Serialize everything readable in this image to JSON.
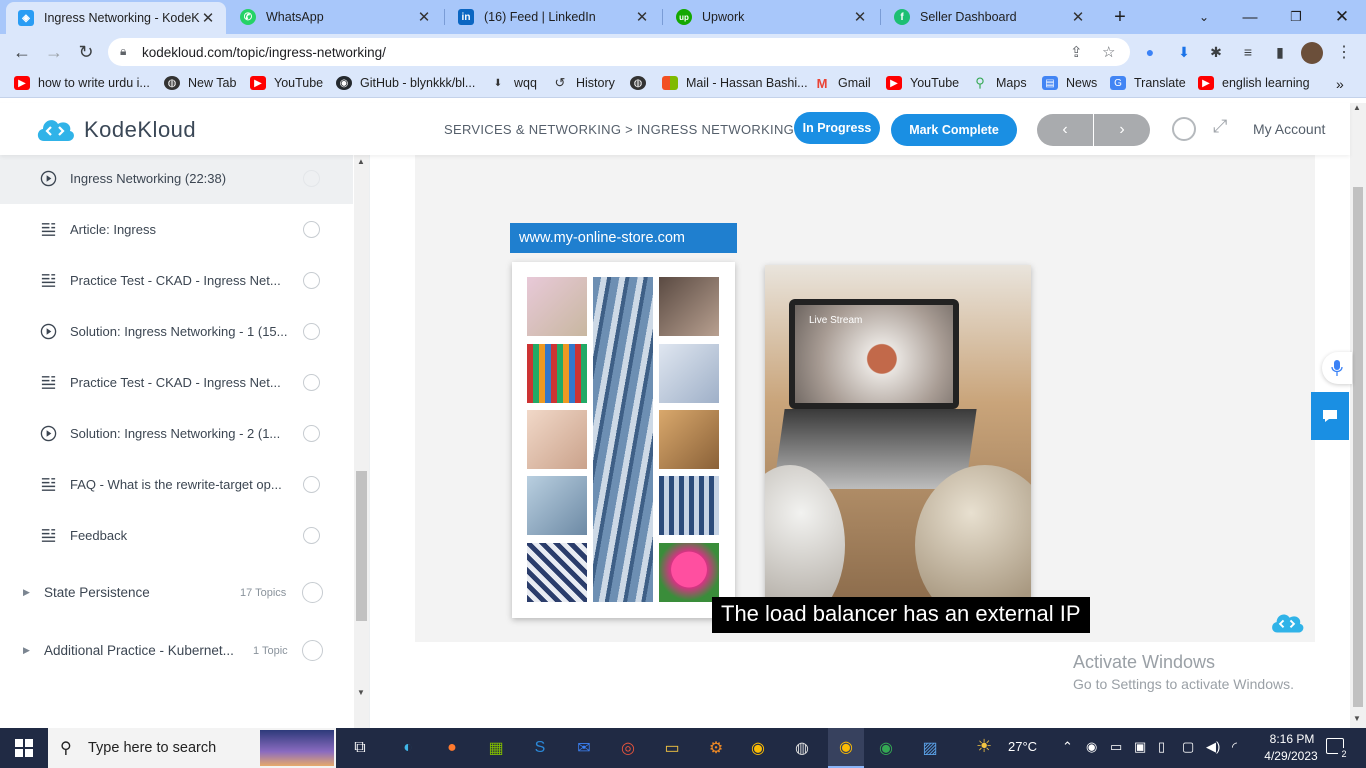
{
  "browser": {
    "tabs": [
      {
        "title": "Ingress Networking - KodeKl",
        "favicon": "kodekloud-icon",
        "active": true
      },
      {
        "title": "WhatsApp",
        "favicon": "whatsapp-icon",
        "active": false
      },
      {
        "title": "(16) Feed | LinkedIn",
        "favicon": "linkedin-icon",
        "active": false
      },
      {
        "title": "Upwork",
        "favicon": "upwork-icon",
        "active": false
      },
      {
        "title": "Seller Dashboard",
        "favicon": "fiverr-icon",
        "active": false
      }
    ],
    "url": "kodekloud.com/topic/ingress-networking/",
    "bookmarks": [
      {
        "label": "how to write urdu i...",
        "icon": "youtube-icon"
      },
      {
        "label": "New Tab",
        "icon": "globe-icon"
      },
      {
        "label": "YouTube",
        "icon": "youtube-icon"
      },
      {
        "label": "GitHub - blynkkk/bl...",
        "icon": "github-icon"
      },
      {
        "label": "wqq",
        "icon": "download-icon"
      },
      {
        "label": "History",
        "icon": "history-icon"
      },
      {
        "label": "",
        "icon": "globe-icon"
      },
      {
        "label": "Mail - Hassan Bashi...",
        "icon": "microsoft-icon"
      },
      {
        "label": "Gmail",
        "icon": "gmail-icon"
      },
      {
        "label": "YouTube",
        "icon": "youtube-icon"
      },
      {
        "label": "Maps",
        "icon": "maps-icon"
      },
      {
        "label": "News",
        "icon": "news-icon"
      },
      {
        "label": "Translate",
        "icon": "translate-icon"
      },
      {
        "label": "english learning",
        "icon": "youtube-icon"
      }
    ]
  },
  "site": {
    "logo": "KodeKloud",
    "breadcrumb": "SERVICES & NETWORKING > INGRESS NETWORKING",
    "status_label": "In Progress",
    "mark_complete_label": "Mark Complete",
    "account_label": "My Account"
  },
  "sidebar": {
    "lessons": [
      {
        "label": "Ingress Networking (22:38)",
        "icon": "play-icon",
        "current": true
      },
      {
        "label": "Article: Ingress",
        "icon": "article-icon",
        "current": false
      },
      {
        "label": "Practice Test - CKAD - Ingress Net...",
        "icon": "article-icon",
        "current": false
      },
      {
        "label": "Solution: Ingress Networking - 1 (15...",
        "icon": "play-icon",
        "current": false
      },
      {
        "label": "Practice Test - CKAD - Ingress Net...",
        "icon": "article-icon",
        "current": false
      },
      {
        "label": "Solution: Ingress Networking - 2 (1...",
        "icon": "play-icon",
        "current": false
      },
      {
        "label": "FAQ - What is the rewrite-target op...",
        "icon": "article-icon",
        "current": false
      },
      {
        "label": "Feedback",
        "icon": "article-icon",
        "current": false
      }
    ],
    "topics": [
      {
        "label": "State Persistence",
        "count": "17 Topics"
      },
      {
        "label": "Additional Practice - Kubernet...",
        "count": "1 Topic"
      }
    ]
  },
  "video": {
    "store_url": "www.my-online-store.com",
    "live_label": "Live Stream",
    "caption": "The load balancer has an external IP"
  },
  "windows_notice": {
    "title": "Activate Windows",
    "subtitle": "Go to Settings to activate Windows."
  },
  "taskbar": {
    "search_placeholder": "Type here to search",
    "temperature": "27°C",
    "time": "8:16 PM",
    "date": "4/29/2023",
    "notifications": "2"
  },
  "colors": {
    "accent": "#1a8fe3",
    "chrome_frame": "#a8c7fa",
    "chrome_toolbar": "#dbe7fb",
    "taskbar": "#202a44"
  }
}
